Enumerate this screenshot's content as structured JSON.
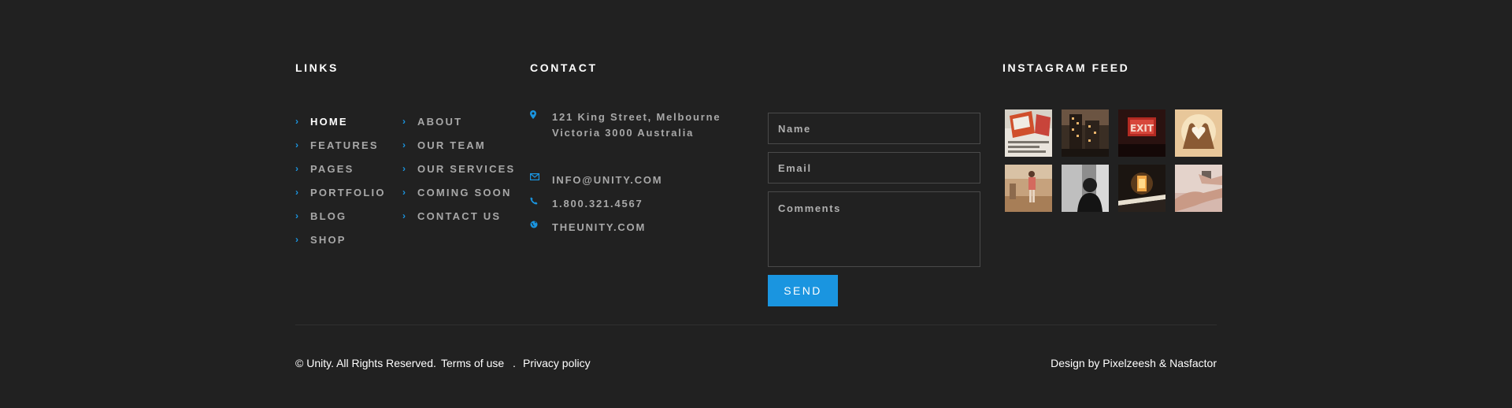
{
  "links": {
    "heading": "LINKS",
    "column1": [
      "HOME",
      "FEATURES",
      "PAGES",
      "PORTFOLIO",
      "BLOG",
      "SHOP"
    ],
    "column2": [
      "ABOUT",
      "OUR TEAM",
      "OUR SERVICES",
      "COMING SOON",
      "CONTACT US"
    ],
    "active": "HOME"
  },
  "contact": {
    "heading": "CONTACT",
    "address_line1": "121 King Street, Melbourne",
    "address_line2": "Victoria 3000 Australia",
    "email": "INFO@UNITY.COM",
    "phone": "1.800.321.4567",
    "website": "THEUNITY.COM",
    "icons": {
      "address": "map-marker-icon",
      "email": "envelope-icon",
      "phone": "phone-icon",
      "website": "globe-icon"
    }
  },
  "form": {
    "name_placeholder": "Name",
    "email_placeholder": "Email",
    "comments_placeholder": "Comments",
    "send_label": "SEND"
  },
  "instagram": {
    "heading": "INSTAGRAM FEED",
    "thumbnails": [
      "newspapers-photo",
      "city-buildings-photo",
      "exit-sign-photo",
      "heart-hands-photo",
      "person-walking-photo",
      "black-white-man-photo",
      "lantern-photo",
      "hands-watch-photo"
    ]
  },
  "footer": {
    "copyright": "© Unity. All Rights Reserved.",
    "terms": "Terms of use",
    "separator": ".",
    "privacy": "Privacy policy",
    "credits": "Design by Pixelzeesh & Nasfactor"
  },
  "colors": {
    "background": "#212121",
    "accent": "#1a95e0",
    "heading": "#ffffff",
    "text": "#a8a8a8"
  }
}
